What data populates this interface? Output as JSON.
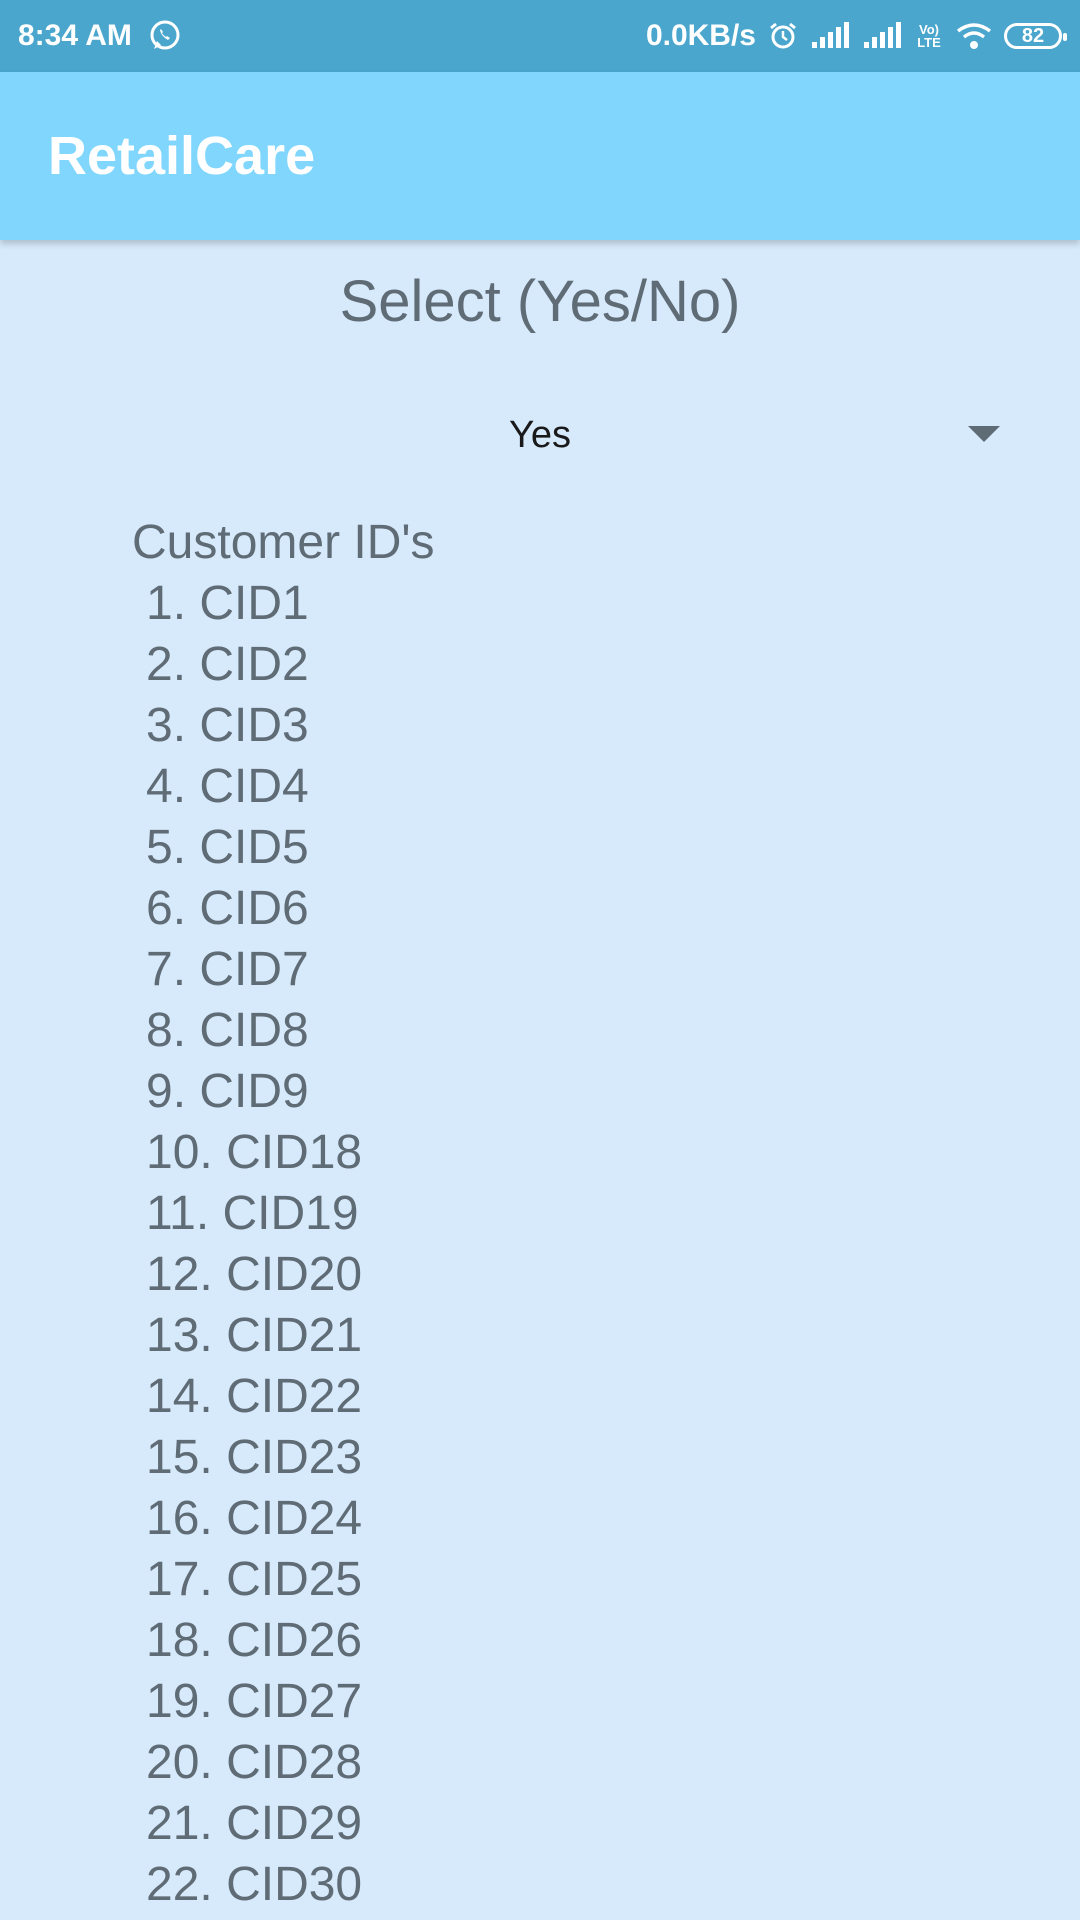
{
  "status_bar": {
    "time": "8:34 AM",
    "whatsapp_icon": "whatsapp-icon",
    "network_speed": "0.0KB/s",
    "alarm_icon": "alarm-icon",
    "signal_icon": "signal-icon",
    "volte_label": "Vo) LTE",
    "wifi_icon": "wifi-icon",
    "battery_level": "82"
  },
  "app_bar": {
    "title": "RetailCare"
  },
  "selector": {
    "heading": "Select (Yes/No)",
    "selected_value": "Yes"
  },
  "customers": {
    "heading": "Customer ID's",
    "items": [
      "1. CID1",
      "2. CID2",
      "3. CID3",
      "4. CID4",
      "5. CID5",
      "6. CID6",
      "7. CID7",
      "8. CID8",
      "9. CID9",
      "10. CID18",
      "11. CID19",
      "12. CID20",
      "13. CID21",
      "14. CID22",
      "15. CID23",
      "16. CID24",
      "17. CID25",
      "18. CID26",
      "19. CID27",
      "20. CID28",
      "21. CID29",
      "22. CID30"
    ]
  },
  "colors": {
    "status_bar": "#4aa6cc",
    "app_bar": "#80d6fd",
    "background": "#d6eafc",
    "text": "#5f6b75"
  }
}
